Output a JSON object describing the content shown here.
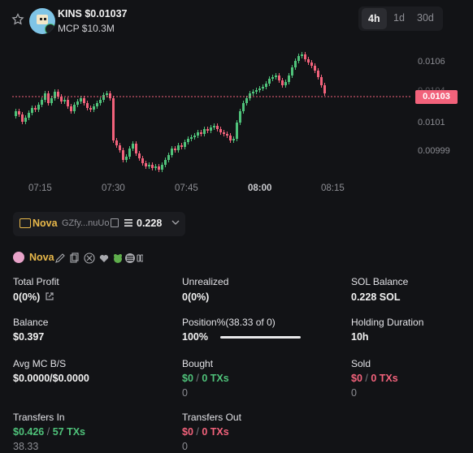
{
  "header": {
    "ticker": "KINS",
    "price": "$0.01037",
    "mcp": "MCP $10.3M",
    "timeframes": [
      "4h",
      "1d",
      "30d"
    ],
    "active_timeframe": "4h"
  },
  "chart_data": {
    "type": "candlestick",
    "x_ticks": [
      "07:15",
      "07:30",
      "07:45",
      "08:00",
      "08:15"
    ],
    "bold_tick": "08:00",
    "y_ticks": [
      "0.0106",
      "0.0104",
      "0.0101",
      "0.00999"
    ],
    "current_price_tag": "0.0103",
    "up_color": "#4fc27a",
    "down_color": "#f2627b"
  },
  "wallet": {
    "name": "Nova",
    "address": "GZfy...nuUo",
    "balance": "0.228"
  },
  "profile": {
    "name": "Nova"
  },
  "stats": {
    "total_profit_label": "Total Profit",
    "total_profit_value": "0(0%)",
    "unrealized_label": "Unrealized",
    "unrealized_value": "0(0%)",
    "sol_balance_label": "SOL Balance",
    "sol_balance_value": "0.228 SOL",
    "balance_label": "Balance",
    "balance_value": "$0.397",
    "position_label": "Position%(38.33 of 0)",
    "position_value": "100%",
    "position_fraction": 1.0,
    "holding_label": "Holding Duration",
    "holding_value": "10h",
    "avg_mc_label": "Avg MC B/S",
    "avg_mc_value": "$0.0000/$0.0000",
    "bought_label": "Bought",
    "bought_usd": "$0",
    "bought_txs": "0 TXs",
    "bought_sub": "0",
    "sold_label": "Sold",
    "sold_usd": "$0",
    "sold_txs": "0 TXs",
    "sold_sub": "0",
    "transfers_in_label": "Transfers In",
    "transfers_in_usd": "$0.426",
    "transfers_in_txs": "57 TXs",
    "transfers_in_sub": "38.33",
    "transfers_out_label": "Transfers Out",
    "transfers_out_usd": "$0",
    "transfers_out_txs": "0 TXs",
    "transfers_out_sub": "0",
    "separator": "/"
  }
}
